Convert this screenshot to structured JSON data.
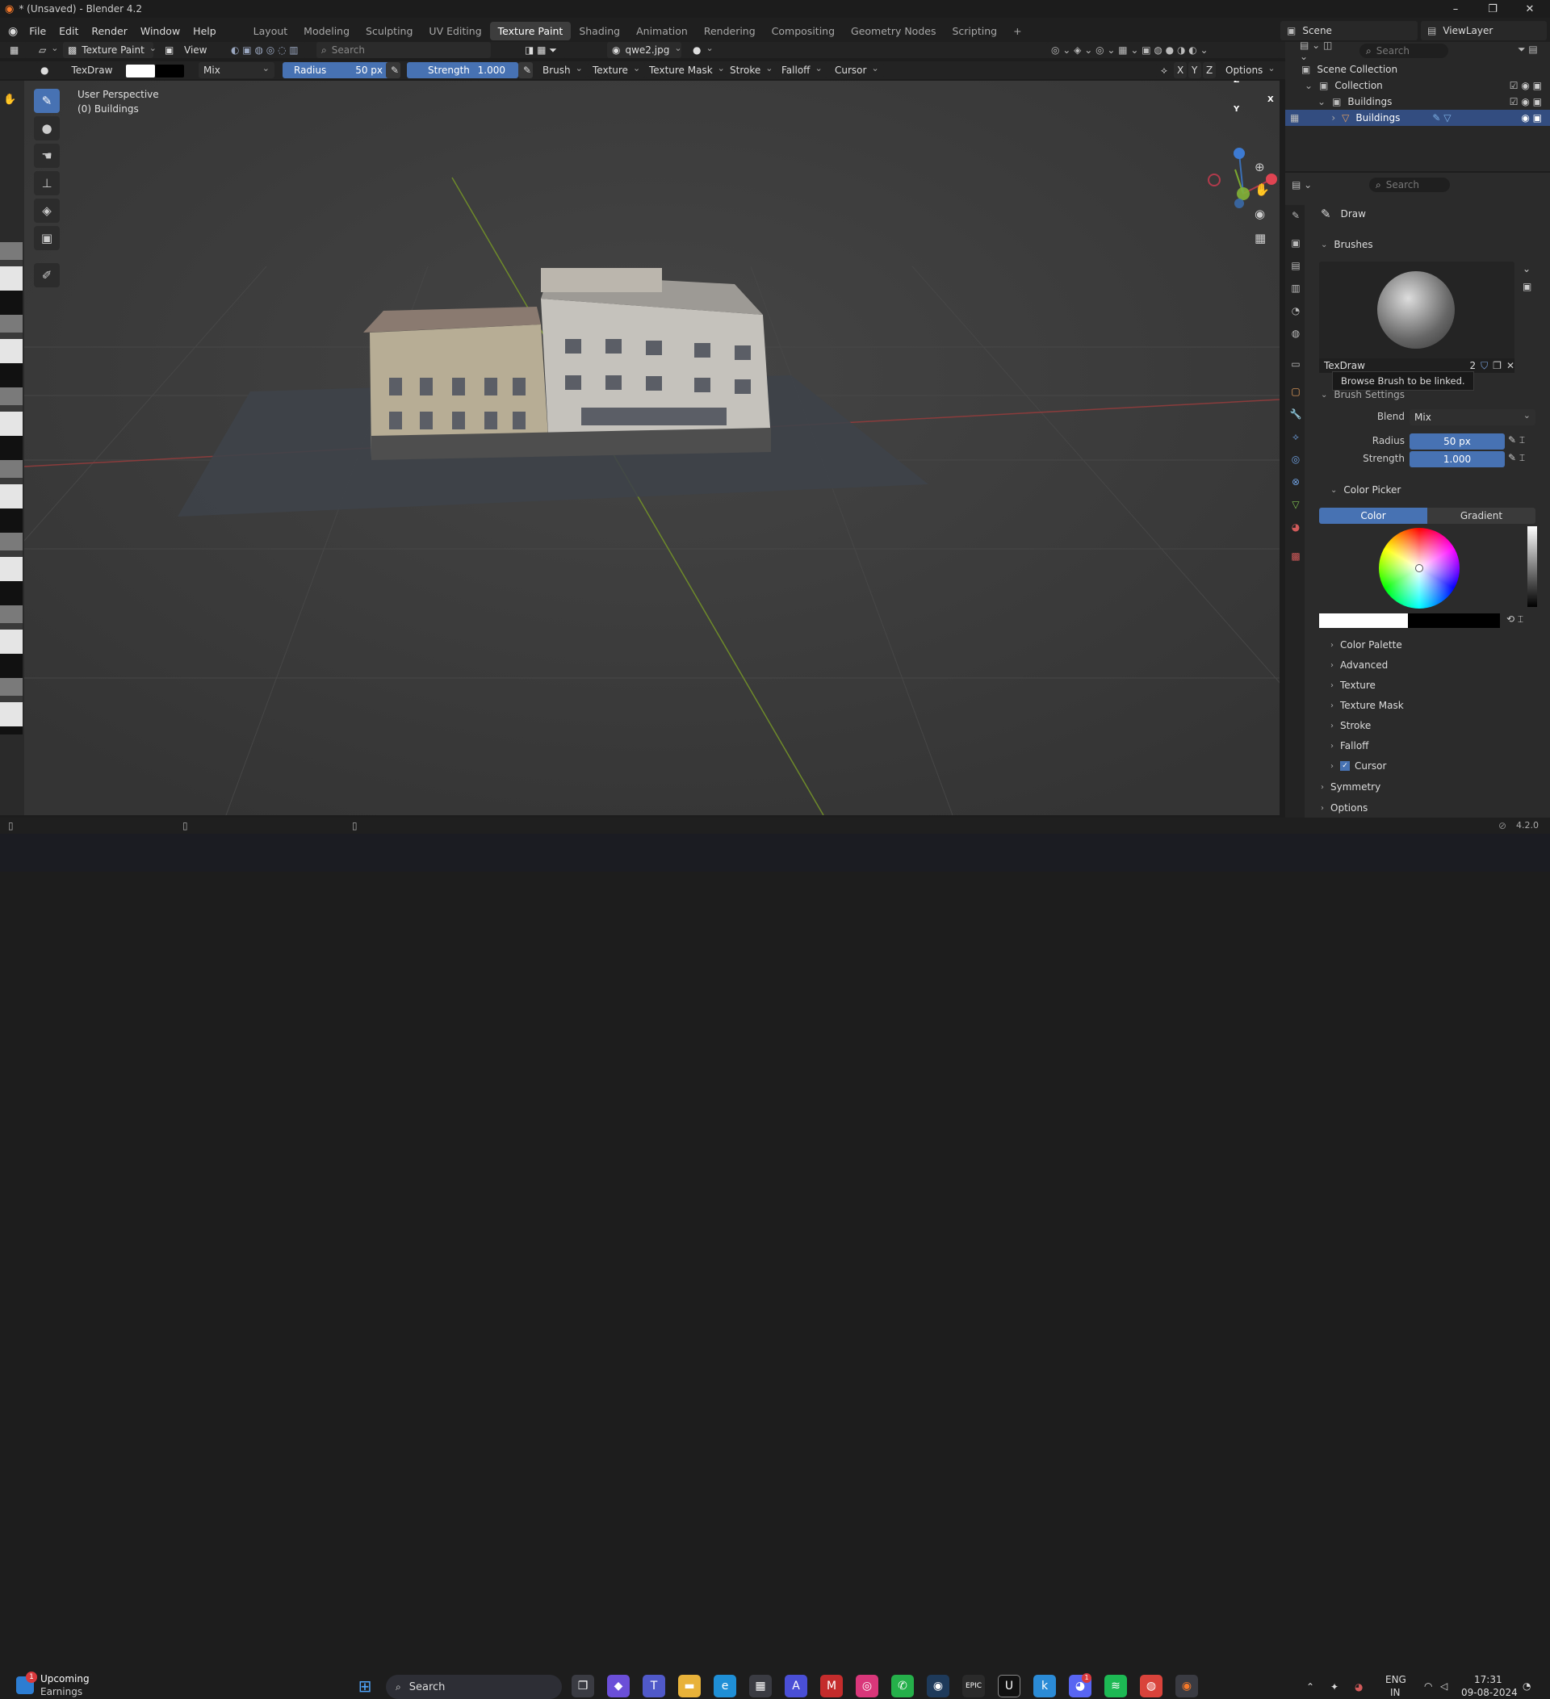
{
  "titlebar": {
    "title": "* (Unsaved) - Blender 4.2",
    "minimize": "–",
    "maximize": "❐",
    "close": "✕"
  },
  "menu": {
    "items": [
      "File",
      "Edit",
      "Render",
      "Window",
      "Help"
    ]
  },
  "workspaces": {
    "tabs": [
      "Layout",
      "Modeling",
      "Sculpting",
      "UV Editing",
      "Texture Paint",
      "Shading",
      "Animation",
      "Rendering",
      "Compositing",
      "Geometry Nodes",
      "Scripting"
    ],
    "active": "Texture Paint",
    "add": "+"
  },
  "scene": {
    "scene_label": "Scene",
    "viewlayer_label": "ViewLayer"
  },
  "header1": {
    "mode": "Texture Paint",
    "view": "View",
    "search_placeholder": "Search",
    "image": "qwe2.jpg"
  },
  "header2": {
    "brush_name": "TexDraw",
    "blend": "Mix",
    "radius_label": "Radius",
    "radius_value": "50 px",
    "strength_label": "Strength",
    "strength_value": "1.000",
    "menus": [
      "Brush",
      "Texture",
      "Texture Mask",
      "Stroke",
      "Falloff",
      "Cursor"
    ],
    "axes": [
      "X",
      "Y",
      "Z"
    ],
    "options": "Options"
  },
  "viewport": {
    "perspective": "User Perspective",
    "object": "(0) Buildings",
    "gizmo_x": "X",
    "gizmo_y": "Y",
    "gizmo_z": "Z"
  },
  "outliner": {
    "search_placeholder": "Search",
    "rows": [
      "Scene Collection",
      "Collection",
      "Buildings",
      "Buildings"
    ]
  },
  "properties": {
    "search_placeholder": "Search",
    "tool_name": "Draw",
    "brushes_label": "Brushes",
    "brush_name": "TexDraw",
    "brush_users": "2",
    "tooltip": "Browse Brush to be linked.",
    "brush_settings_label": "Brush Settings",
    "blend_label": "Blend",
    "blend_value": "Mix",
    "radius_label": "Radius",
    "radius_value": "50 px",
    "strength_label": "Strength",
    "strength_value": "1.000",
    "color_picker_label": "Color Picker",
    "color_tab": "Color",
    "gradient_tab": "Gradient",
    "sections": [
      "Color Palette",
      "Advanced",
      "Texture",
      "Texture Mask",
      "Stroke",
      "Falloff",
      "Cursor"
    ],
    "symmetry": "Symmetry",
    "options": "Options",
    "primary_color": "#ffffff",
    "secondary_color": "#000000"
  },
  "statusbar": {
    "version": "4.2.0"
  },
  "taskbar": {
    "widget_title": "Upcoming",
    "widget_sub": "Earnings",
    "widget_badge": "1",
    "search": "Search",
    "lang": "ENG",
    "region": "IN",
    "time": "17:31",
    "date": "09-08-2024",
    "discord_badge": "1"
  },
  "colors": {
    "accent": "#4772b3",
    "selection": "#334d80",
    "viewport_bg": "#3b3b3b"
  }
}
